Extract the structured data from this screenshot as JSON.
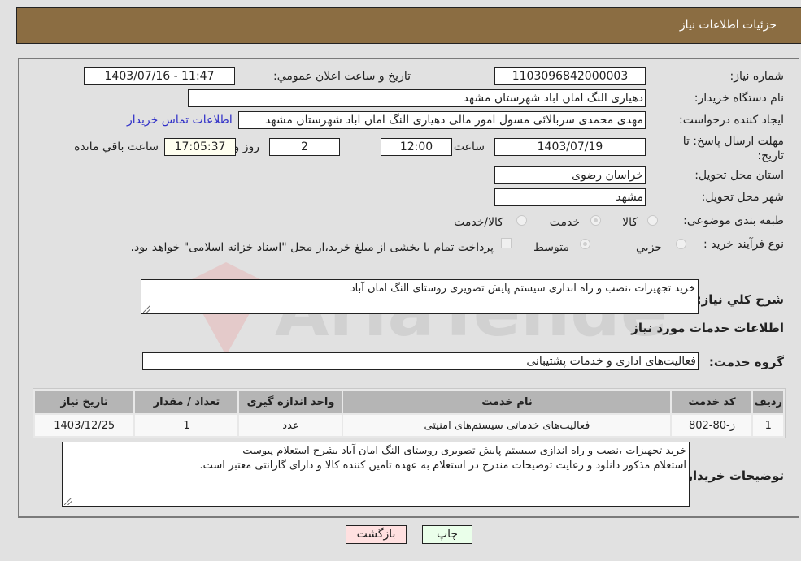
{
  "header": {
    "title": "جزئیات اطلاعات نیاز"
  },
  "form": {
    "need_number": {
      "label": "شماره نیاز:",
      "value": "1103096842000003"
    },
    "announce_datetime": {
      "label": "تاریخ و ساعت اعلان عمومي:",
      "value": "1403/07/16 - 11:47"
    },
    "buyer_org": {
      "label": "نام دستگاه خريدار:",
      "value": "دهیاری النگ امان اباد شهرستان مشهد"
    },
    "requester": {
      "label": "ايجاد کننده درخواست:",
      "value": "مهدی محمدی سربالائی مسول امور مالی دهیاری النگ امان اباد شهرستان مشهد",
      "contact_link": "اطلاعات تماس خريدار"
    },
    "deadline": {
      "label": "مهلت ارسال پاسخ: تا تاریخ:",
      "date": "1403/07/19",
      "time_label": "ساعت",
      "time": "12:00",
      "days": "2",
      "days_label": "روز و",
      "remaining": "17:05:37",
      "remaining_label": "ساعت باقي مانده"
    },
    "province": {
      "label": "استان محل تحويل:",
      "value": "خراسان رضوی"
    },
    "city": {
      "label": "شهر محل تحويل:",
      "value": "مشهد"
    },
    "category": {
      "label": "طبقه بندی موضوعی:",
      "options": [
        {
          "label": "کالا",
          "selected": false
        },
        {
          "label": "خدمت",
          "selected": true
        },
        {
          "label": "کالا/خدمت",
          "selected": false
        }
      ]
    },
    "purchase_type": {
      "label": "نوع فرآیند خرید :",
      "options": [
        {
          "label": "جزيي",
          "selected": false
        },
        {
          "label": "متوسط",
          "selected": true
        }
      ],
      "payment_note": "پرداخت تمام يا بخشی از مبلغ خريد،از محل \"اسناد خزانه اسلامی\" خواهد بود.",
      "payment_checked": false
    }
  },
  "summary": {
    "label": "شرح کلي نياز:",
    "value": "خرید تجهیزات ،نصب و راه اندازی سیستم پایش تصویری روستای النگ امان آباد"
  },
  "services_section": {
    "title": "اطلاعات خدمات مورد نياز",
    "group_label": "گروه خدمت:",
    "group_value": "فعالیت‌های اداری و خدمات پشتیبانی"
  },
  "table": {
    "headers": [
      "رديف",
      "کد خدمت",
      "نام خدمت",
      "واحد اندازه گيری",
      "تعداد / مقدار",
      "تاريخ نياز"
    ],
    "rows": [
      [
        "1",
        "ز-80-802",
        "فعالیت‌های خدماتی سیستم‌های امنیتی",
        "عدد",
        "1",
        "1403/12/25"
      ]
    ]
  },
  "buyer_notes": {
    "label": "توضيحات خريدار:",
    "line1": "خرید تجهیزات ،نصب و راه اندازی سیستم پایش تصویری روستای النگ امان آباد بشرح استعلام پیوست",
    "line2": "استعلام مذکور دانلود و رعایت توضیحات مندرج در استعلام  به عهده تامین کننده کالا و دارای گارانتی معتبر است."
  },
  "buttons": {
    "print": "چاپ",
    "back": "بازگشت"
  },
  "colors": {
    "header_bg": "#8b6d42",
    "print_bg": "#eaffea",
    "back_bg": "#ffe0e0",
    "link": "#3030c8"
  }
}
